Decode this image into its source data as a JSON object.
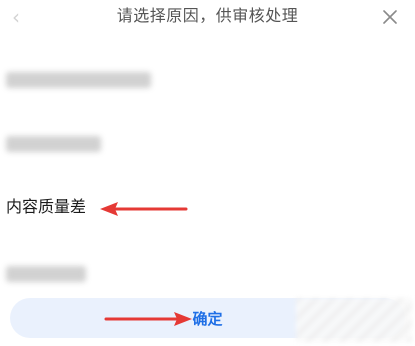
{
  "header": {
    "title": "请选择原因，供审核处理",
    "back_icon": "chevron-left-icon",
    "close_icon": "close-icon"
  },
  "options": [
    {
      "label": "",
      "state": "blurred"
    },
    {
      "label": "",
      "state": "blurred"
    },
    {
      "label": "内容质量差",
      "state": "visible"
    },
    {
      "label": "",
      "state": "blurred"
    }
  ],
  "confirm": {
    "label": "确定"
  },
  "colors": {
    "accent": "#1f6fe6",
    "button_bg": "#eaf1fd",
    "arrow": "#e53935"
  }
}
